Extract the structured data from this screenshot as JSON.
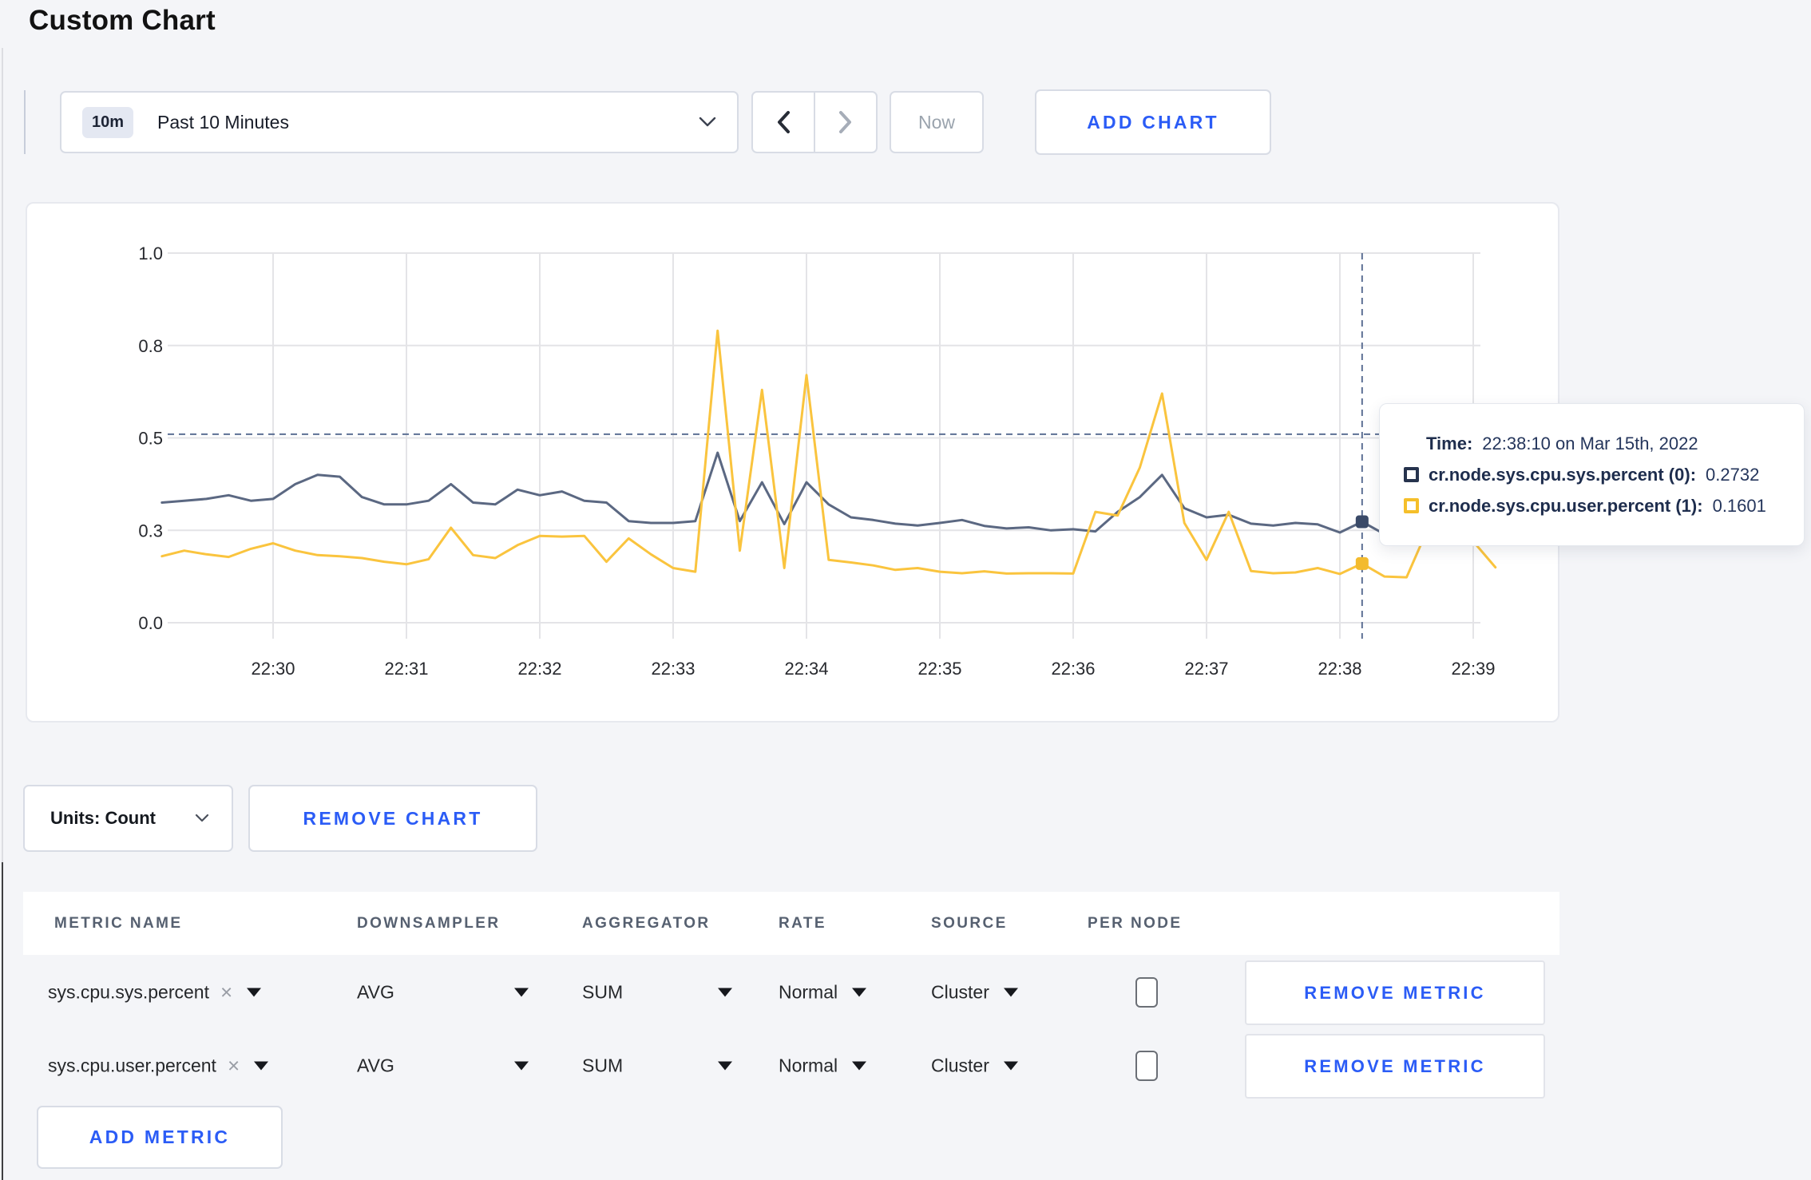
{
  "page": {
    "title": "Custom Chart"
  },
  "toolbar": {
    "time_badge": "10m",
    "time_label": "Past 10 Minutes",
    "prev_icon": "chevron-left",
    "next_icon": "chevron-right",
    "now_label": "Now",
    "add_chart_label": "ADD CHART"
  },
  "accent_colors": {
    "link_blue": "#2b5cf6",
    "series_blue": "#5b6882",
    "series_yellow": "#fac43e"
  },
  "chart_data": {
    "type": "line",
    "title": "",
    "grid": true,
    "legend_position": "none",
    "ylim": [
      0,
      1
    ],
    "x_axis_note": "time of day, one vertical gridline per minute",
    "x_unit": "seconds since 22:29:00",
    "y_ticks": [
      {
        "v": 0.0,
        "label": "0.0"
      },
      {
        "v": 0.25,
        "label": "0.3"
      },
      {
        "v": 0.5,
        "label": "0.5"
      },
      {
        "v": 0.75,
        "label": "0.8"
      },
      {
        "v": 1.0,
        "label": "1.0"
      }
    ],
    "x_ticks": [
      {
        "t": 60,
        "label": "22:30"
      },
      {
        "t": 120,
        "label": "22:31"
      },
      {
        "t": 180,
        "label": "22:32"
      },
      {
        "t": 240,
        "label": "22:33"
      },
      {
        "t": 300,
        "label": "22:34"
      },
      {
        "t": 360,
        "label": "22:35"
      },
      {
        "t": 420,
        "label": "22:36"
      },
      {
        "t": 480,
        "label": "22:37"
      },
      {
        "t": 540,
        "label": "22:38"
      },
      {
        "t": 600,
        "label": "22:39"
      }
    ],
    "crosshair": {
      "t": 550,
      "hline_value": 0.51,
      "color": "#5d7094"
    },
    "series": [
      {
        "name": "cr.node.sys.cpu.sys.percent",
        "color": "#5b6882",
        "marker_color": "#3a4a68",
        "points": [
          [
            10,
            0.325
          ],
          [
            20,
            0.33
          ],
          [
            30,
            0.335
          ],
          [
            40,
            0.345
          ],
          [
            50,
            0.33
          ],
          [
            60,
            0.335
          ],
          [
            70,
            0.375
          ],
          [
            80,
            0.4
          ],
          [
            90,
            0.395
          ],
          [
            100,
            0.34
          ],
          [
            110,
            0.32
          ],
          [
            120,
            0.32
          ],
          [
            130,
            0.33
          ],
          [
            140,
            0.375
          ],
          [
            150,
            0.325
          ],
          [
            160,
            0.32
          ],
          [
            170,
            0.36
          ],
          [
            180,
            0.345
          ],
          [
            190,
            0.355
          ],
          [
            200,
            0.33
          ],
          [
            210,
            0.325
          ],
          [
            220,
            0.275
          ],
          [
            230,
            0.27
          ],
          [
            240,
            0.27
          ],
          [
            250,
            0.275
          ],
          [
            260,
            0.46
          ],
          [
            270,
            0.275
          ],
          [
            280,
            0.38
          ],
          [
            290,
            0.267
          ],
          [
            300,
            0.38
          ],
          [
            310,
            0.32
          ],
          [
            320,
            0.285
          ],
          [
            330,
            0.278
          ],
          [
            340,
            0.268
          ],
          [
            350,
            0.263
          ],
          [
            360,
            0.27
          ],
          [
            370,
            0.278
          ],
          [
            380,
            0.262
          ],
          [
            390,
            0.255
          ],
          [
            400,
            0.258
          ],
          [
            410,
            0.25
          ],
          [
            420,
            0.253
          ],
          [
            430,
            0.247
          ],
          [
            440,
            0.3
          ],
          [
            450,
            0.34
          ],
          [
            460,
            0.4
          ],
          [
            470,
            0.31
          ],
          [
            480,
            0.285
          ],
          [
            490,
            0.292
          ],
          [
            500,
            0.268
          ],
          [
            510,
            0.263
          ],
          [
            520,
            0.27
          ],
          [
            530,
            0.266
          ],
          [
            540,
            0.244
          ],
          [
            550,
            0.2732
          ],
          [
            560,
            0.24
          ],
          [
            570,
            0.26
          ],
          [
            580,
            0.27
          ],
          [
            590,
            0.27
          ],
          [
            600,
            0.27
          ],
          [
            610,
            0.27
          ]
        ]
      },
      {
        "name": "cr.node.sys.cpu.user.percent",
        "color": "#fac43e",
        "marker_color": "#f3bb2e",
        "points": [
          [
            10,
            0.18
          ],
          [
            20,
            0.195
          ],
          [
            30,
            0.185
          ],
          [
            40,
            0.178
          ],
          [
            50,
            0.2
          ],
          [
            60,
            0.215
          ],
          [
            70,
            0.195
          ],
          [
            80,
            0.183
          ],
          [
            90,
            0.18
          ],
          [
            100,
            0.175
          ],
          [
            110,
            0.165
          ],
          [
            120,
            0.158
          ],
          [
            130,
            0.172
          ],
          [
            140,
            0.257
          ],
          [
            150,
            0.183
          ],
          [
            160,
            0.175
          ],
          [
            170,
            0.21
          ],
          [
            180,
            0.235
          ],
          [
            190,
            0.233
          ],
          [
            200,
            0.235
          ],
          [
            210,
            0.165
          ],
          [
            220,
            0.228
          ],
          [
            230,
            0.185
          ],
          [
            240,
            0.148
          ],
          [
            250,
            0.138
          ],
          [
            260,
            0.79
          ],
          [
            270,
            0.195
          ],
          [
            280,
            0.63
          ],
          [
            290,
            0.148
          ],
          [
            300,
            0.67
          ],
          [
            310,
            0.17
          ],
          [
            320,
            0.163
          ],
          [
            330,
            0.155
          ],
          [
            340,
            0.143
          ],
          [
            350,
            0.148
          ],
          [
            360,
            0.138
          ],
          [
            370,
            0.134
          ],
          [
            380,
            0.139
          ],
          [
            390,
            0.133
          ],
          [
            400,
            0.134
          ],
          [
            410,
            0.134
          ],
          [
            420,
            0.133
          ],
          [
            430,
            0.3
          ],
          [
            440,
            0.29
          ],
          [
            450,
            0.42
          ],
          [
            460,
            0.62
          ],
          [
            470,
            0.27
          ],
          [
            480,
            0.17
          ],
          [
            490,
            0.3
          ],
          [
            500,
            0.14
          ],
          [
            510,
            0.134
          ],
          [
            520,
            0.136
          ],
          [
            530,
            0.148
          ],
          [
            540,
            0.132
          ],
          [
            550,
            0.1601
          ],
          [
            560,
            0.125
          ],
          [
            570,
            0.123
          ],
          [
            580,
            0.26
          ],
          [
            590,
            0.3
          ],
          [
            600,
            0.22
          ],
          [
            610,
            0.15
          ]
        ]
      }
    ]
  },
  "tooltip": {
    "time_label": "Time:",
    "time_value": "22:38:10 on Mar 15th, 2022",
    "series": [
      {
        "label": "cr.node.sys.cpu.sys.percent (0):",
        "value": "0.2732",
        "color": "#26334d"
      },
      {
        "label": "cr.node.sys.cpu.user.percent (1):",
        "value": "0.1601",
        "color": "#f5bf2a"
      }
    ]
  },
  "chart_controls": {
    "units_label": "Units: Count",
    "remove_chart_label": "REMOVE CHART"
  },
  "metrics_table": {
    "headers": [
      "METRIC NAME",
      "DOWNSAMPLER",
      "AGGREGATOR",
      "RATE",
      "SOURCE",
      "PER NODE"
    ],
    "rows": [
      {
        "metric": "sys.cpu.sys.percent",
        "downsampler": "AVG",
        "aggregator": "SUM",
        "rate": "Normal",
        "source": "Cluster",
        "per_node": false,
        "remove_label": "REMOVE METRIC"
      },
      {
        "metric": "sys.cpu.user.percent",
        "downsampler": "AVG",
        "aggregator": "SUM",
        "rate": "Normal",
        "source": "Cluster",
        "per_node": false,
        "remove_label": "REMOVE METRIC"
      }
    ],
    "add_metric_label": "ADD METRIC"
  }
}
